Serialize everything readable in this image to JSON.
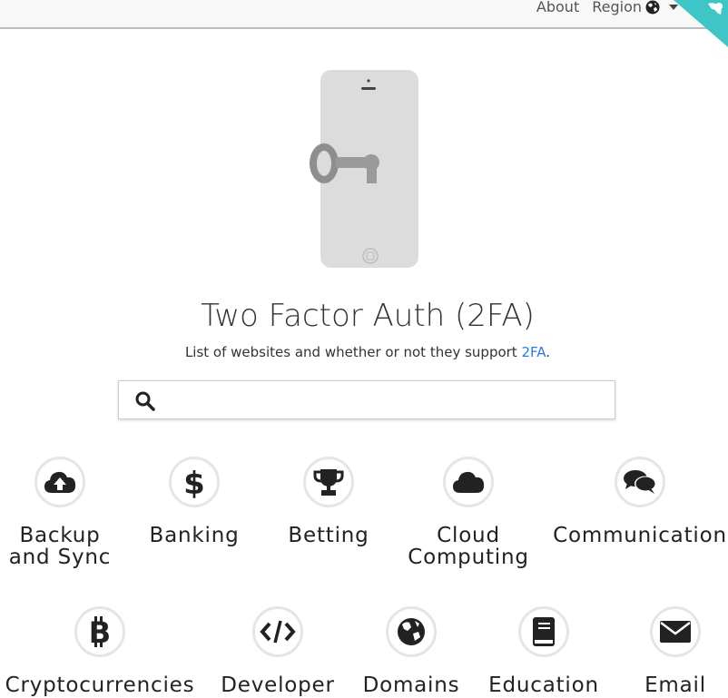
{
  "nav": {
    "about": "About",
    "region": "Region"
  },
  "hero": {
    "title": "Two Factor Auth (2FA)",
    "subtitle_text": "List of websites and whether or not they support ",
    "subtitle_link": "2FA",
    "subtitle_end": "."
  },
  "search": {
    "placeholder": "",
    "value": ""
  },
  "categories": [
    {
      "label": "Backup\nand Sync",
      "icon": "cloud-upload-icon"
    },
    {
      "label": "Banking",
      "icon": "dollar-icon"
    },
    {
      "label": "Betting",
      "icon": "trophy-icon"
    },
    {
      "label": "Cloud\nComputing",
      "icon": "cloud-icon"
    },
    {
      "label": "Communication",
      "icon": "comments-icon"
    },
    {
      "label": "Cryptocurrencies",
      "icon": "bitcoin-icon"
    },
    {
      "label": "Developer",
      "icon": "code-icon"
    },
    {
      "label": "Domains",
      "icon": "globe-icon"
    },
    {
      "label": "Education",
      "icon": "book-icon"
    },
    {
      "label": "Email",
      "icon": "envelope-icon"
    }
  ],
  "colors": {
    "accent": "#2a7ae2",
    "corner": "#3ec6c6"
  }
}
